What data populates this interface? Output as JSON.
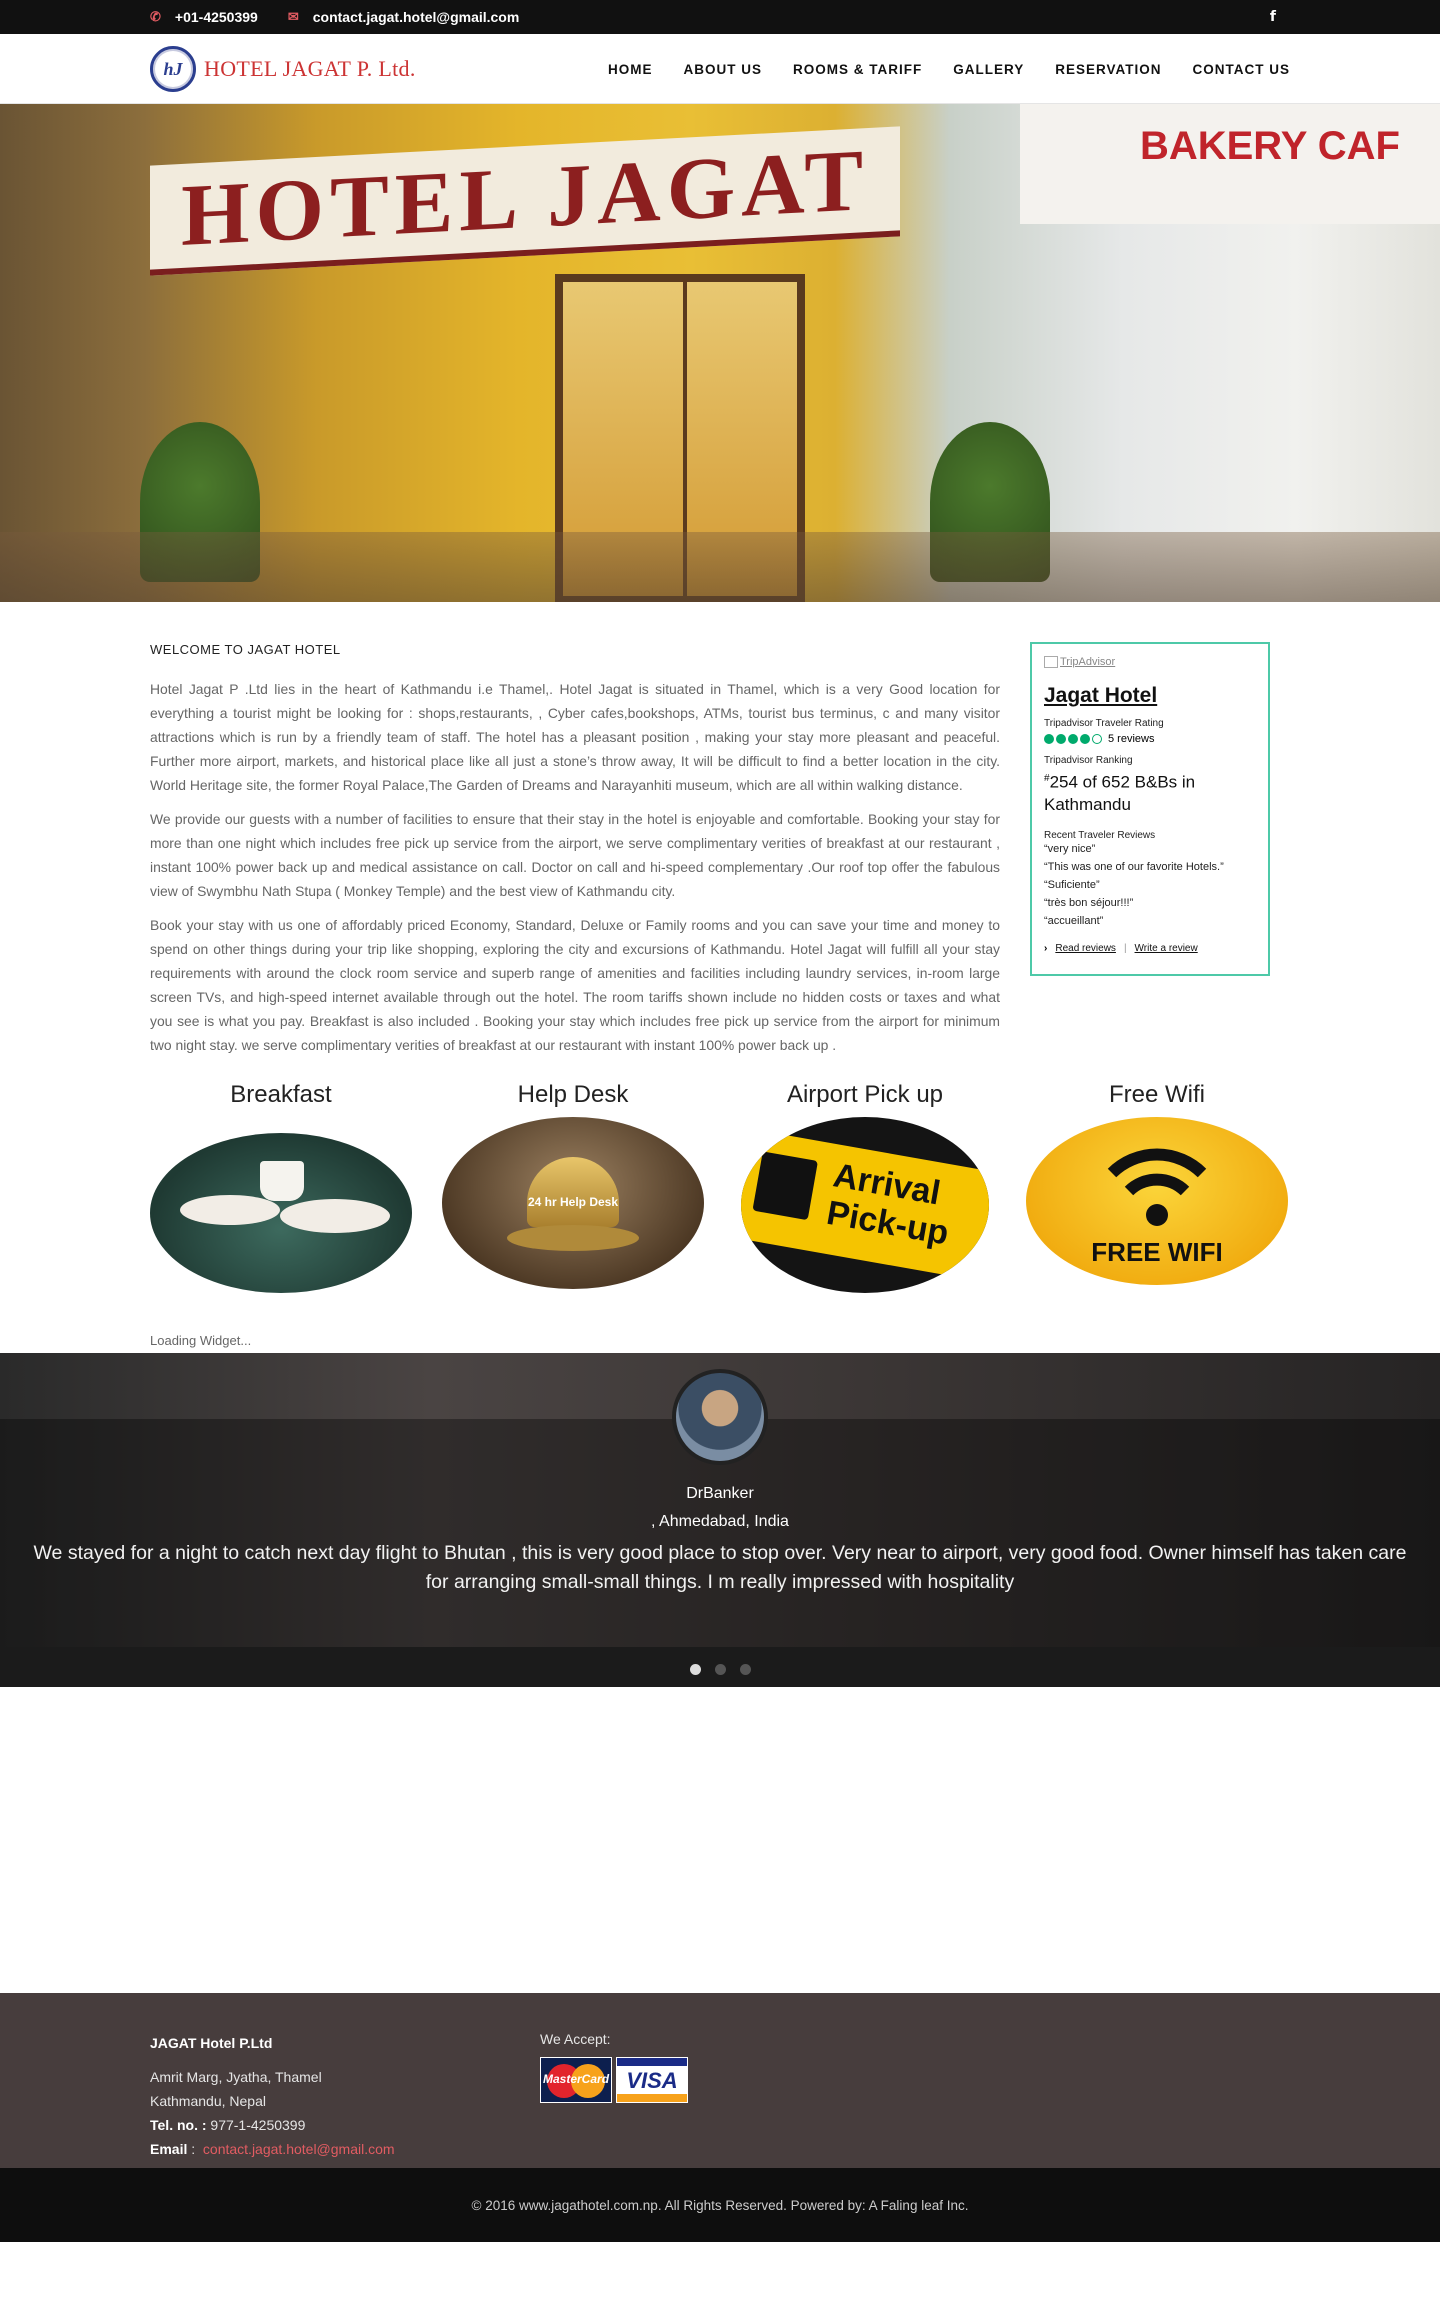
{
  "topbar": {
    "phone": "+01-4250399",
    "email": "contact.jagat.hotel@gmail.com",
    "facebook_icon": "f"
  },
  "header": {
    "logo_mark": "hJ",
    "logo_text": "HOTEL JAGAT P. Ltd.",
    "nav": [
      "HOME",
      "ABOUT US",
      "ROOMS & TARIFF",
      "GALLERY",
      "RESERVATION",
      "CONTACT US"
    ]
  },
  "hero": {
    "sign": "HOTEL JAGAT",
    "cafe": "BAKERY CAF"
  },
  "main": {
    "welcome": "WELCOME TO JAGAT HOTEL",
    "paragraphs": [
      "Hotel Jagat P .Ltd lies  in the heart of  Kathmandu i.e Thamel,. Hotel Jagat is situated in Thamel, which is a very Good location for everything a tourist might be looking for : shops,restaurants, , Cyber cafes,bookshops, ATMs, tourist bus terminus, c and many visitor attractions which is run  by a friendly team of staff. The hotel has a pleasant position , making your stay more pleasant and peaceful. Further more airport, markets, and historical place like all just a stone’s throw away, It will be difficult to find a better location in the city. World Heritage site, the former Royal Palace,The Garden of Dreams and   Narayanhiti museum,  which are all within walking distance.",
      "We provide our guests with a number of facilities to ensure that their stay in the hotel is enjoyable and comfortable. Booking your stay for more than one night  which includes free pick up service from the airport, we serve complimentary verities of breakfast at our restaurant , instant 100% power back up and medical assistance on call. Doctor on call and hi-speed complementary .Our roof top offer the fabulous view of Swymbhu Nath Stupa ( Monkey Temple) and the best view of Kathmandu city.",
      "Book your stay with us one of affordably priced Economy, Standard, Deluxe or Family rooms and you can save your time and money to spend on other things during your trip like shopping, exploring the city and excursions of Kathmandu. Hotel Jagat will fulfill all your stay requirements with around the clock room service and superb range of amenities and facilities including laundry services, in-room large screen TVs, and high-speed internet available through out the hotel. The room tariffs shown include no hidden costs or taxes and what you see is what you pay. Breakfast is also included . Booking your stay which includes free pick up service from the airport for minimum two night stay. we serve complimentary verities of breakfast at our restaurant  with instant 100% power back up ."
    ]
  },
  "tripadvisor": {
    "logo_alt": "TripAdvisor",
    "hotel_name": "Jagat Hotel",
    "rating_label": "Tripadvisor Traveler Rating",
    "rating_bubbles": 4,
    "rating_max": 5,
    "reviews_count": "5 reviews",
    "ranking_label": "Tripadvisor Ranking",
    "rank_hash": "#",
    "ranking": "254 of 652 B&Bs in Kathmandu",
    "recent_label": "Recent Traveler Reviews",
    "reviews": [
      "“very nice”",
      "“This was one of our favorite Hotels.”",
      "“Suficiente”",
      "“très bon séjour!!!”",
      "“accueillant”"
    ],
    "read_reviews": "Read reviews",
    "separator": "|",
    "write_review": "Write a review"
  },
  "features": [
    {
      "title": "Breakfast"
    },
    {
      "title": "Help Desk",
      "image_text": "24 hr Help Desk"
    },
    {
      "title": "Airport Pick up",
      "image_text": "Arrival Pick-up"
    },
    {
      "title": "Free Wifi",
      "image_text": "FREE WIFI"
    }
  ],
  "loading": "Loading Widget...",
  "testimonial": {
    "name": "DrBanker",
    "location": ", Ahmedabad, India",
    "quote": "We stayed for a night to catch next day flight to Bhutan , this is very good place to stop over. Very near to airport, very good food. Owner himself has taken care for arranging small-small things. I m really impressed with hospitality",
    "slides": 3,
    "active_slide": 1
  },
  "footer": {
    "company": "JAGAT Hotel P.Ltd",
    "address1": "Amrit Marg, Jyatha, Thamel",
    "address2": "Kathmandu, Nepal",
    "tel_label": "Tel. no. :",
    "tel": "977-1-4250399",
    "email_label": "Email",
    "email_sep": ":",
    "email": "contact.jagat.hotel@gmail.com",
    "accept_label": "We Accept:",
    "card1": "MasterCard",
    "card2": "VISA"
  },
  "copyright": "© 2016 www.jagathotel.com.np. All Rights Reserved. Powered by: A Faling leaf Inc."
}
